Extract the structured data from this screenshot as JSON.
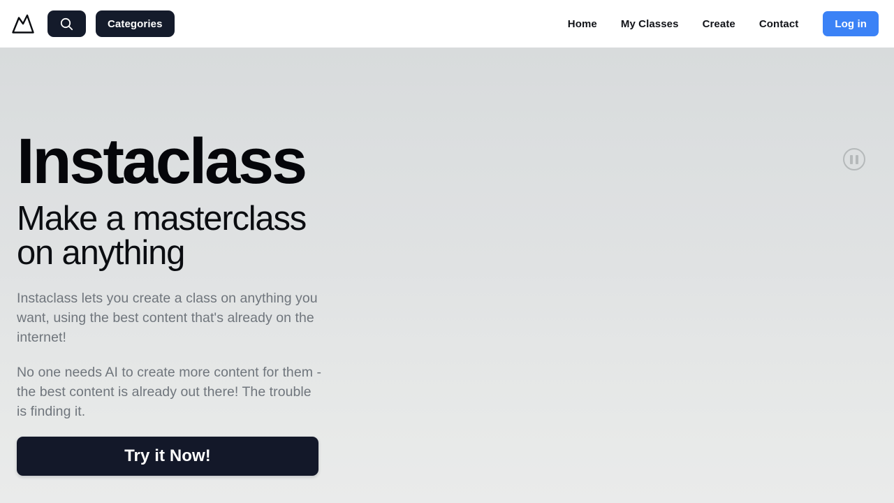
{
  "theme": {
    "header_bg": "#ffffff",
    "dark": "#141b2b",
    "accent_blue": "#3b82f6",
    "hero_gradient_top": "#d8dbdc",
    "hero_gradient_bottom": "#eaebeb",
    "body_text": "#6f757c"
  },
  "header": {
    "logo_name": "mountain-logo",
    "search": {
      "icon": "search-icon",
      "label": ""
    },
    "categories_label": "Categories",
    "nav_links": [
      {
        "label": "Home"
      },
      {
        "label": "My Classes"
      },
      {
        "label": "Create"
      },
      {
        "label": "Contact"
      }
    ],
    "login_label": "Log in"
  },
  "hero": {
    "title": "Instaclass",
    "subtitle": "Make a masterclass on anything",
    "paragraph_1": "Instaclass lets you create a class on anything you want, using the best content that's already on the internet!",
    "paragraph_2": "No one needs AI to create more content for them - the best content is already out there! The trouble is finding it.",
    "cta_label": "Try it Now!",
    "media_control": {
      "icon": "pause-icon",
      "state": "playing"
    }
  }
}
